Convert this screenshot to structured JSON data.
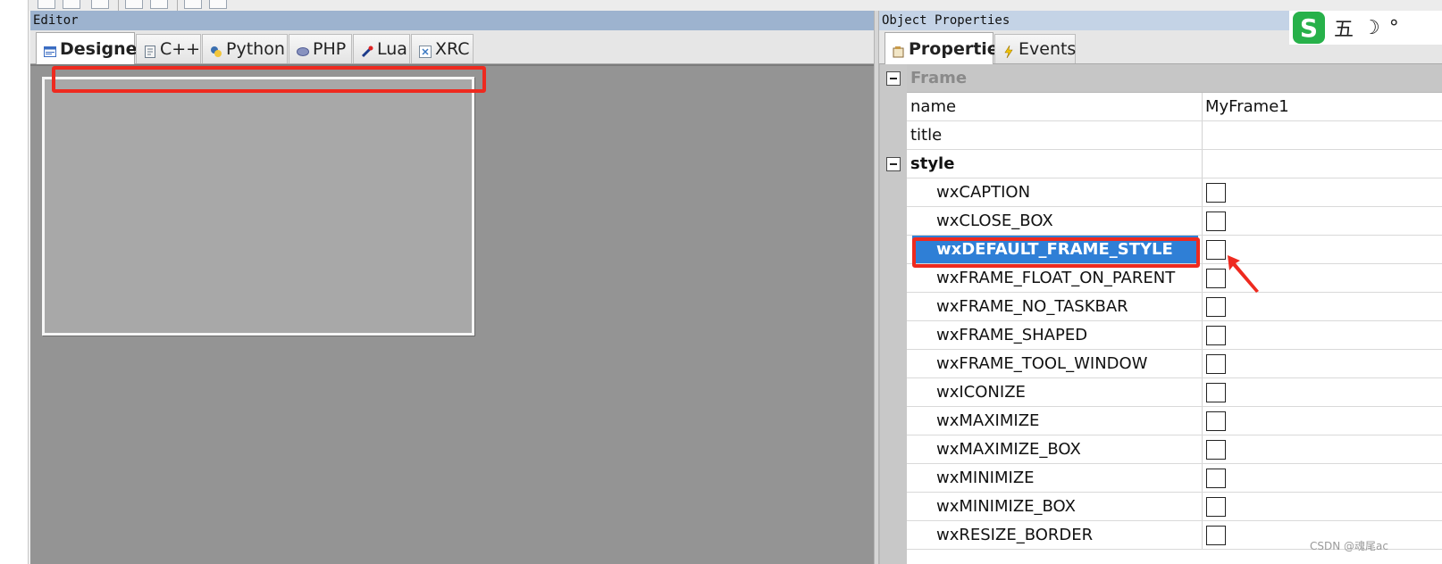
{
  "editor": {
    "caption": "Editor",
    "tabs": [
      {
        "label": "Designer",
        "icon": "designer-icon"
      },
      {
        "label": "C++",
        "icon": "cpp-icon"
      },
      {
        "label": "Python",
        "icon": "python-icon"
      },
      {
        "label": "PHP",
        "icon": "php-icon"
      },
      {
        "label": "Lua",
        "icon": "lua-icon"
      },
      {
        "label": "XRC",
        "icon": "xrc-icon"
      }
    ],
    "active_tab": "Designer"
  },
  "properties": {
    "caption": "Object Properties",
    "tabs": [
      {
        "label": "Properties",
        "icon": "properties-icon"
      },
      {
        "label": "Events",
        "icon": "events-icon"
      }
    ],
    "active_tab": "Properties",
    "category": "Frame",
    "rows": [
      {
        "name": "name",
        "value": "MyFrame1"
      },
      {
        "name": "title",
        "value": ""
      },
      {
        "name": "style",
        "value": ""
      }
    ],
    "style_flags": [
      "wxCAPTION",
      "wxCLOSE_BOX",
      "wxDEFAULT_FRAME_STYLE",
      "wxFRAME_FLOAT_ON_PARENT",
      "wxFRAME_NO_TASKBAR",
      "wxFRAME_SHAPED",
      "wxFRAME_TOOL_WINDOW",
      "wxICONIZE",
      "wxMAXIMIZE",
      "wxMAXIMIZE_BOX",
      "wxMINIMIZE",
      "wxMINIMIZE_BOX",
      "wxRESIZE_BORDER"
    ],
    "selected_flag": "wxDEFAULT_FRAME_STYLE"
  },
  "ime": {
    "logo": "S",
    "mode": "五",
    "icons": [
      "moon-icon",
      "degree-icon"
    ],
    "moon": "☽",
    "degree": "°"
  },
  "watermark": "CSDN @魂尾ac",
  "colors": {
    "highlight": "#ee2a1f",
    "selection": "#2f7fd6",
    "canvas": "#949494"
  }
}
